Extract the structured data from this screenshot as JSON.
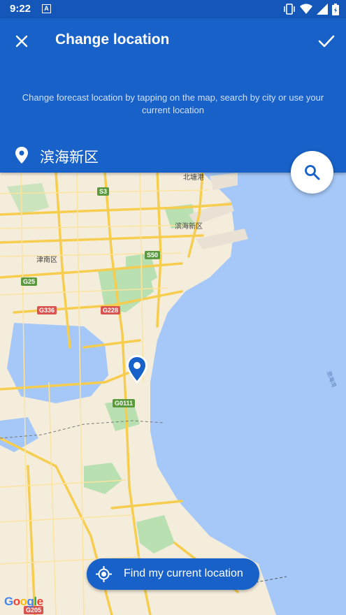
{
  "status_bar": {
    "time": "9:22",
    "notification_letter": "A"
  },
  "appbar": {
    "title": "Change location",
    "subtitle": "Change forecast location by tapping on the map, search by city or use your current location",
    "location_name": "滨海新区"
  },
  "map": {
    "labels": {
      "beitang": "北塘港",
      "binhai": "滨海新区",
      "jinnan": "津南区",
      "bohai": "渤海湾"
    },
    "shields": {
      "s3": "S3",
      "s50": "S50",
      "g25": "G25",
      "g336": "G336",
      "g228": "G228",
      "g0111": "G0111",
      "g205": "G205"
    },
    "attribution": "Google"
  },
  "find_button": {
    "label": "Find my current location"
  },
  "colors": {
    "primary": "#1761c8",
    "status": "#1557b8",
    "water": "#a5c8f8",
    "land": "#f5eddc",
    "road": "#f6cd4e",
    "green": "#b9e0b0"
  }
}
